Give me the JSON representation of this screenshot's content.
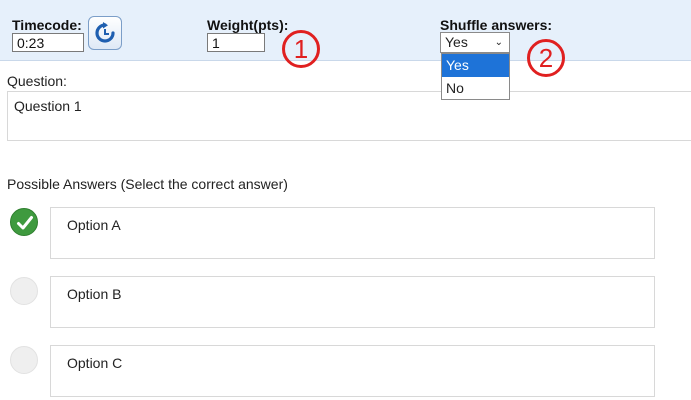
{
  "header": {
    "timecode_label": "Timecode:",
    "timecode_value": "0:23",
    "refresh_icon": "refresh-icon",
    "weight_label": "Weight(pts):",
    "weight_value": "1",
    "shuffle_label": "Shuffle answers:",
    "shuffle_selected": "Yes",
    "shuffle_options": [
      "Yes",
      "No"
    ]
  },
  "callouts": [
    "1",
    "2"
  ],
  "question": {
    "label": "Question:",
    "text": "Question 1"
  },
  "answers": {
    "label": "Possible Answers (Select the correct answer)",
    "options": [
      {
        "text": "Option A",
        "correct": true
      },
      {
        "text": "Option B",
        "correct": false
      },
      {
        "text": "Option C",
        "correct": false
      }
    ]
  },
  "colors": {
    "header_bg": "#e6f0fb",
    "accent_blue": "#1e73d8",
    "callout_red": "#e02020",
    "correct_green": "#3f9a3f"
  }
}
